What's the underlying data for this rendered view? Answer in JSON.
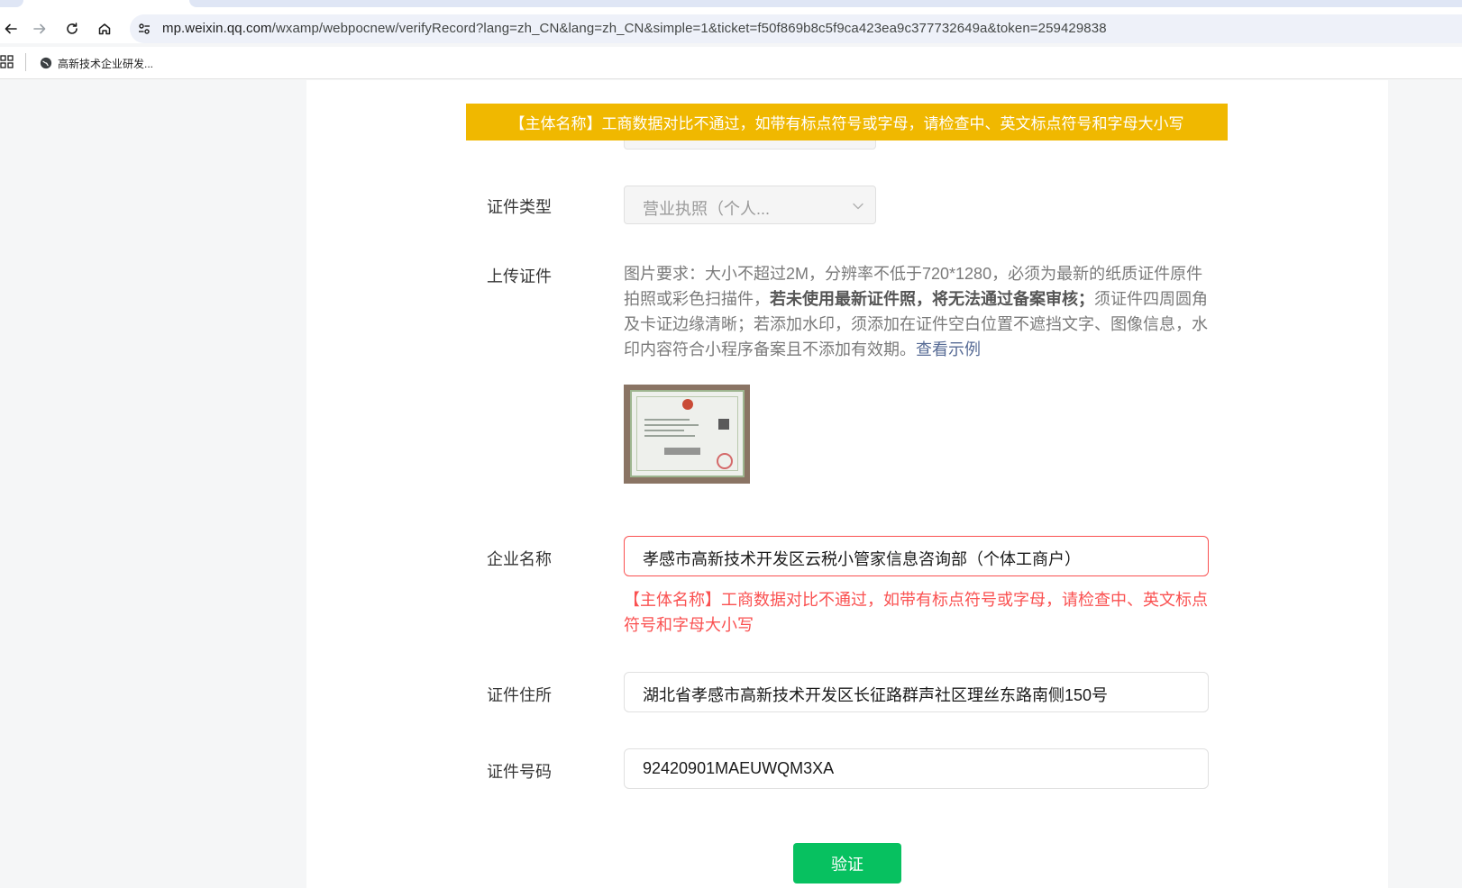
{
  "browser": {
    "url_host": "mp.weixin.qq.com",
    "url_path": "/wxamp/webpocnew/verifyRecord?lang=zh_CN&lang=zh_CN&simple=1&ticket=f50f869b8c5f9ca423ea9c377732649a&token=259429838",
    "bookmark_label": "高新技术企业研发..."
  },
  "banner": {
    "text": "【主体名称】工商数据对比不通过，如带有标点符号或字母，请检查中、英文标点符号和字母大小写"
  },
  "form": {
    "cert_type": {
      "label": "证件类型",
      "value": "营业执照（个人..."
    },
    "upload": {
      "label": "上传证件",
      "desc_part1": "图片要求：大小不超过2M，分辨率不低于720*1280，必须为最新的纸质证件原件拍照或彩色扫描件，",
      "desc_bold": "若未使用最新证件照，将无法通过备案审核；",
      "desc_part2": "须证件四周圆角及卡证边缘清晰；若添加水印，须添加在证件空白位置不遮挡文字、图像信息，水印内容符合小程序备案且不添加有效期。",
      "example_link": "查看示例"
    },
    "company_name": {
      "label": "企业名称",
      "value": "孝感市高新技术开发区云税小管家信息咨询部（个体工商户）",
      "error": "【主体名称】工商数据对比不通过，如带有标点符号或字母，请检查中、英文标点符号和字母大小写"
    },
    "address": {
      "label": "证件住所",
      "value": "湖北省孝感市高新技术开发区长征路群声社区理丝东路南侧150号"
    },
    "cert_number": {
      "label": "证件号码",
      "value": "92420901MAEUWQM3XA"
    },
    "verify_button": "验证"
  },
  "colors": {
    "banner_bg": "#f0b800",
    "error": "#fa5151",
    "primary_button": "#07c160",
    "link": "#576b95"
  }
}
